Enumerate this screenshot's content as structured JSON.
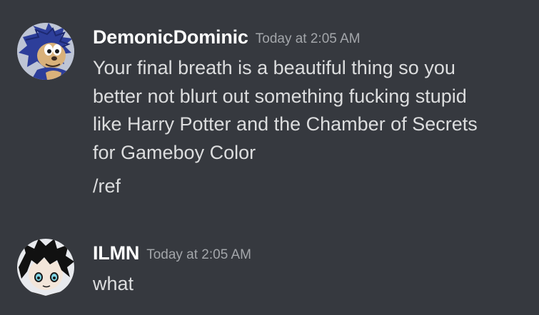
{
  "messages": [
    {
      "username": "DemonicDominic",
      "timestamp": "Today at 2:05 AM",
      "lines": [
        "Your final breath is a beautiful thing so you",
        "better not blurt out something fucking stupid",
        "like Harry Potter and the Chamber of Secrets",
        "for Gameboy Color"
      ],
      "followup": "/ref",
      "avatar_icon": "blue-hedgehog-avatar-icon"
    },
    {
      "username": "ILMN",
      "timestamp": "Today at 2:05 AM",
      "lines": [
        "what"
      ],
      "avatar_icon": "black-hair-character-avatar-icon"
    }
  ],
  "colors": {
    "background": "#36393f",
    "username": "#ffffff",
    "timestamp": "#a3a6aa",
    "text": "#dcddde"
  }
}
